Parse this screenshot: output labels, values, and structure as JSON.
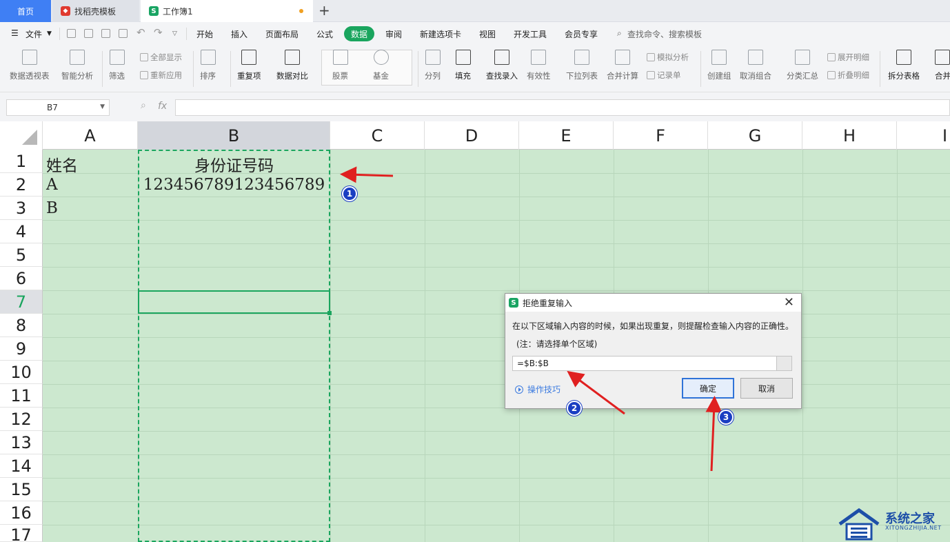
{
  "tabs": {
    "home": "首页",
    "template": "找稻壳模板",
    "workbook": "工作簿1"
  },
  "menu": {
    "file": "文件",
    "items": [
      "开始",
      "插入",
      "页面布局",
      "公式",
      "数据",
      "审阅",
      "新建选项卡",
      "视图",
      "开发工具",
      "会员专享"
    ],
    "search": "查找命令、搜索模板"
  },
  "ribbon": {
    "pivot": "数据透视表",
    "smart": "智能分析",
    "filter": "筛选",
    "show_all": "全部显示",
    "reapply": "重新应用",
    "sort": "排序",
    "duplicates": "重复项",
    "compare": "数据对比",
    "stock": "股票",
    "fund": "基金",
    "split": "分列",
    "fill": "填充",
    "lookup": "查找录入",
    "validity": "有效性",
    "dropdown": "下拉列表",
    "consolidate": "合并计算",
    "simulate": "模拟分析",
    "record": "记录单",
    "group": "创建组",
    "ungroup": "取消组合",
    "subtotal": "分类汇总",
    "expand": "展开明细",
    "collapse": "折叠明细",
    "split_table": "拆分表格",
    "merge": "合并"
  },
  "formula_bar": {
    "cell_ref": "B7",
    "fx": "fx",
    "formula": ""
  },
  "sheet": {
    "columns": [
      "A",
      "B",
      "C",
      "D",
      "E",
      "F",
      "G",
      "H",
      "I"
    ],
    "rows": [
      "1",
      "2",
      "3",
      "4",
      "5",
      "6",
      "7",
      "8",
      "9",
      "10",
      "11",
      "12",
      "13",
      "14",
      "15",
      "16",
      "17"
    ],
    "cells": {
      "A1": "姓名",
      "B1": "身份证号码",
      "A2": "A",
      "B2": "123456789123456789",
      "A3": "B"
    }
  },
  "dialog": {
    "title": "拒绝重复输入",
    "description": "在以下区域输入内容的时候，如果出现重复，则提醒检查输入内容的正确性。",
    "note": "(注：请选择单个区域)",
    "range": "=$B:$B",
    "tips": "操作技巧",
    "ok": "确定",
    "cancel": "取消"
  },
  "annotations": [
    "1",
    "2",
    "3"
  ],
  "watermark": {
    "name": "系统之家",
    "url": "XITONGZHIJIA.NET"
  },
  "colors": {
    "accent": "#1aa55e",
    "sheet_bg": "#cce8cf",
    "arrow": "#e02020",
    "badge": "#1a3ec2"
  }
}
